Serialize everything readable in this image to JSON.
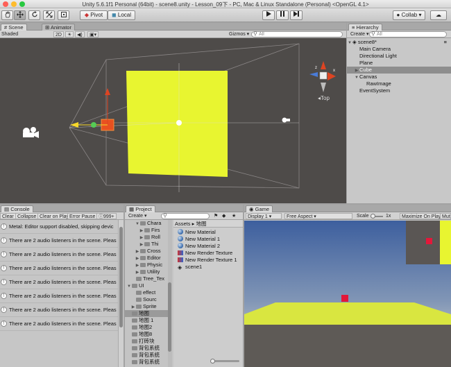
{
  "window": {
    "title": "Unity 5.6.1f1 Personal (64bit) - scene8.unity - Lesson_09下 - PC, Mac & Linux Standalone (Personal) <OpenGL 4.1>"
  },
  "toolbar": {
    "tools": [
      {
        "icon": "hand-icon"
      },
      {
        "icon": "move-icon"
      },
      {
        "icon": "rotate-icon"
      },
      {
        "icon": "scale-icon"
      },
      {
        "icon": "rect-tool-icon"
      }
    ],
    "pivot": "Pivot",
    "local": "Local",
    "collab": "Collab ▾"
  },
  "scene_panel": {
    "tabs": [
      "Scene",
      "Animator"
    ],
    "shading": "Shaded",
    "mode_2d": "2D",
    "gizmos": "Gizmos ▾",
    "search_placeholder": "All",
    "orientation_label": "Top"
  },
  "hierarchy": {
    "tab": "Hierarchy",
    "create": "Create ▾",
    "search_placeholder": "All",
    "scene": "scene8*",
    "items": [
      {
        "label": "Main Camera",
        "depth": 1,
        "expand": "",
        "selected": false
      },
      {
        "label": "Directional Light",
        "depth": 1,
        "expand": "",
        "selected": false
      },
      {
        "label": "Plane",
        "depth": 1,
        "expand": "",
        "selected": false
      },
      {
        "label": "Cube",
        "depth": 1,
        "expand": "▶",
        "selected": true
      },
      {
        "label": "Canvas",
        "depth": 1,
        "expand": "▼",
        "selected": false
      },
      {
        "label": "RawImage",
        "depth": 2,
        "expand": "",
        "selected": false
      },
      {
        "label": "EventSystem",
        "depth": 1,
        "expand": "",
        "selected": false
      }
    ]
  },
  "console": {
    "tab": "Console",
    "buttons": [
      "Clear",
      "Collapse",
      "Clear on Play",
      "Error Pause"
    ],
    "count": "999+",
    "messages": [
      "Metal: Editor support disabled, skipping devic",
      "There are 2 audio listeners in the scene. Pleas",
      "There are 2 audio listeners in the scene. Pleas",
      "There are 2 audio listeners in the scene. Pleas",
      "There are 2 audio listeners in the scene. Pleas",
      "There are 2 audio listeners in the scene. Pleas",
      "There are 2 audio listeners in the scene. Pleas",
      "There are 2 audio listeners in the scene. Pleas"
    ]
  },
  "project": {
    "tab": "Project",
    "create": "Create ▾",
    "tree": [
      {
        "label": "Chara",
        "depth": 3,
        "expand": "▼"
      },
      {
        "label": "Firs",
        "depth": 4,
        "expand": "▶"
      },
      {
        "label": "Roll",
        "depth": 4,
        "expand": "▶"
      },
      {
        "label": "Thi",
        "depth": 4,
        "expand": "▶"
      },
      {
        "label": "Cross",
        "depth": 3,
        "expand": "▶"
      },
      {
        "label": "Editor",
        "depth": 3,
        "expand": "▶"
      },
      {
        "label": "Physic",
        "depth": 3,
        "expand": "▶"
      },
      {
        "label": "Utility",
        "depth": 3,
        "expand": "▶"
      },
      {
        "label": "Tree_Tex",
        "depth": 2,
        "expand": ""
      },
      {
        "label": "UI",
        "depth": 1,
        "expand": "▼"
      },
      {
        "label": "effect",
        "depth": 2,
        "expand": ""
      },
      {
        "label": "Sourc",
        "depth": 2,
        "expand": ""
      },
      {
        "label": "Sprite",
        "depth": 2,
        "expand": "▶"
      },
      {
        "label": "地图",
        "depth": 1,
        "expand": ""
      },
      {
        "label": "地图 1",
        "depth": 1,
        "expand": ""
      },
      {
        "label": "地图2",
        "depth": 1,
        "expand": ""
      },
      {
        "label": "地图8",
        "depth": 1,
        "expand": ""
      },
      {
        "label": "打砖块",
        "depth": 1,
        "expand": ""
      },
      {
        "label": "背包系统",
        "depth": 1,
        "expand": ""
      },
      {
        "label": "背包系统",
        "depth": 1,
        "expand": ""
      },
      {
        "label": "背包系统",
        "depth": 1,
        "expand": ""
      }
    ],
    "breadcrumb": [
      "Assets",
      "▸",
      "地图"
    ],
    "assets": [
      {
        "label": "New Material",
        "kind": "material"
      },
      {
        "label": "New Material 1",
        "kind": "material"
      },
      {
        "label": "New Material 2",
        "kind": "material"
      },
      {
        "label": "New Render Texture",
        "kind": "rendertex"
      },
      {
        "label": "New Render Texture 1",
        "kind": "rendertex"
      },
      {
        "label": "scene1",
        "kind": "scene"
      }
    ]
  },
  "game": {
    "tab": "Game",
    "display": "Display 1",
    "aspect": "Free Aspect",
    "scale_label": "Scale",
    "scale_value": "1x",
    "maximize": "Maximize On Play",
    "mute": "Mute"
  },
  "colors": {
    "scene_bg": "#4e4b49",
    "plane": "#e8f530",
    "selection": "#8e8e8e",
    "sky_top": "#4a6fb0",
    "ground": "#d9e640",
    "cube": "#e3183a"
  }
}
